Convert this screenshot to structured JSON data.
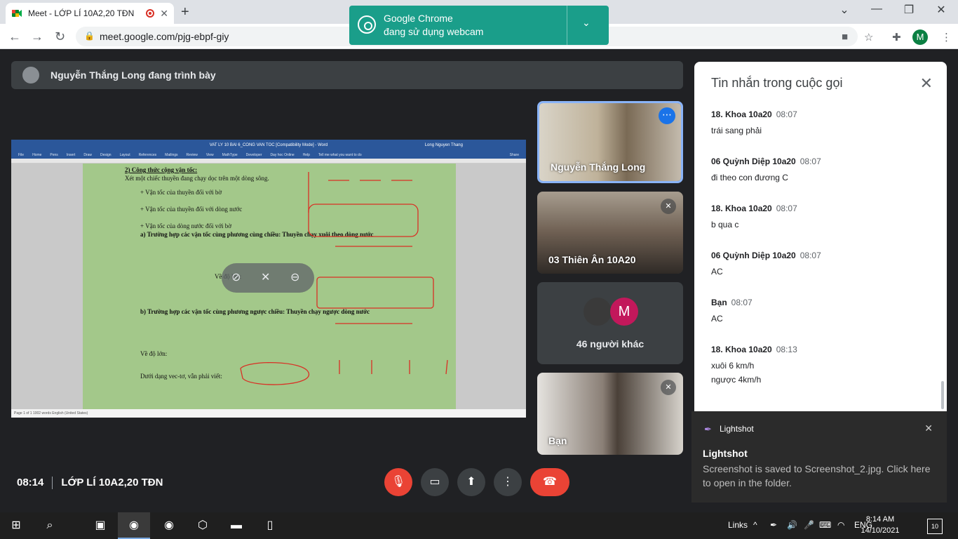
{
  "browser": {
    "tab_title": "Meet - LỚP LÍ 10A2,20 TĐN",
    "url": "meet.google.com/pjg-ebpf-giy",
    "profile_initial": "M"
  },
  "cam_notice": {
    "app": "Google Chrome",
    "text": "đang sử dụng webcam"
  },
  "meet": {
    "presenter_banner": "Nguyễn Thắng Long đang trình bày",
    "time": "08:14",
    "meeting_name": "LỚP LÍ 10A2,20 TĐN"
  },
  "shared_doc": {
    "window_title": "VAT LY 10 BAI 6_CONG VAN TOC [Compatibility Mode] - Word",
    "user": "Long Nguyen Thang",
    "menu": [
      "File",
      "Home",
      "Pens",
      "Insert",
      "Draw",
      "Design",
      "Layout",
      "References",
      "Mailings",
      "Review",
      "View",
      "MathType",
      "Developer",
      "Day hoc Online",
      "Help",
      "Tell me what you want to do",
      "Share"
    ],
    "status": "Page 1 of 1   1002 words   English (United States)",
    "lines": [
      "2) Công thức cộng vận tốc:",
      "Xét một chiếc thuyền đang chạy dọc trên một dòng sông.",
      "+ Vận tốc của thuyền đối với bờ",
      "+ Vận tốc của thuyền đối với dòng nước",
      "+ Vận tốc của dòng nước đối với bờ",
      "a) Trường hợp các vận tốc cùng phương cùng chiều: Thuyền chạy xuôi theo dòng nước",
      "Về độ lớn:",
      "b) Trường hợp các vận tốc cùng phương ngược chiều: Thuyền chạy ngược dòng nước",
      "Về độ lớn:",
      "Dưới dạng vec-tơ, vẫn phải viết:"
    ]
  },
  "participants": [
    {
      "name": "Nguyễn Thắng Long"
    },
    {
      "name": "03 Thiên Ân 10A20"
    },
    {
      "count_label": "46 người khác",
      "avatar_initial": "M"
    },
    {
      "name": "Bạn"
    }
  ],
  "chat": {
    "title": "Tin nhắn trong cuộc gọi",
    "messages": [
      {
        "sender": "18. Khoa 10a20",
        "time": "08:07",
        "text": "trái sang phải"
      },
      {
        "sender": "06 Quỳnh Diệp 10a20",
        "time": "08:07",
        "text": "đi theo con đương C"
      },
      {
        "sender": "18. Khoa 10a20",
        "time": "08:07",
        "text": "b qua c"
      },
      {
        "sender": "06 Quỳnh Diệp 10a20",
        "time": "08:07",
        "text": "AC"
      },
      {
        "sender": "Bạn",
        "time": "08:07",
        "text": "AC"
      },
      {
        "sender": "18. Khoa 10a20",
        "time": "08:13",
        "text": "xuôi 6 km/h",
        "text2": "ngược 4km/h"
      }
    ]
  },
  "toast": {
    "app": "Lightshot",
    "title": "Lightshot",
    "message": "Screenshot is saved to Screenshot_2.jpg. Click here to open in the folder."
  },
  "taskbar": {
    "links": "Links",
    "lang": "ENG",
    "time": "8:14 AM",
    "date": "14/10/2021",
    "notif_count": "10"
  }
}
